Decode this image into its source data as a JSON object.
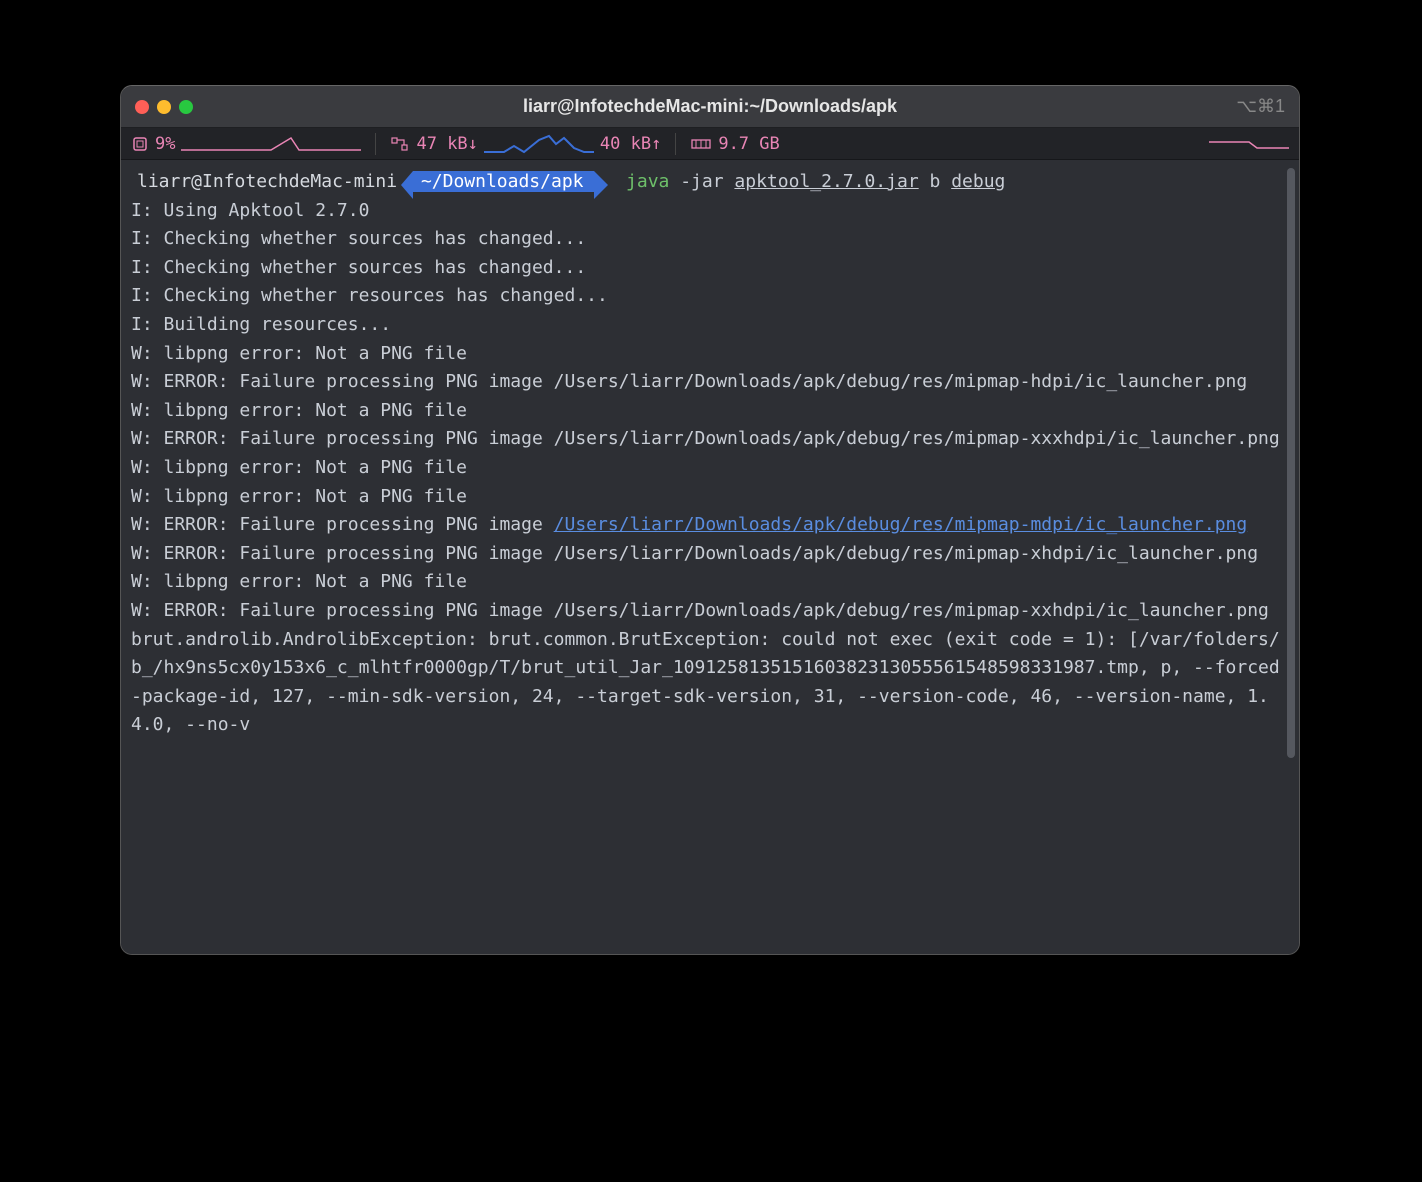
{
  "window": {
    "title": "liarr@InfotechdeMac-mini:~/Downloads/apk",
    "shortcut_hint": "⌥⌘1"
  },
  "status": {
    "cpu_percent": "9%",
    "net_down": "47 kB↓",
    "net_up": "40 kB↑",
    "ram": "9.7 GB"
  },
  "prompt": {
    "user_host": "liarr@InfotechdeMac-mini",
    "path": "~/Downloads/apk",
    "cmd_java": "java",
    "cmd_flag": "-jar",
    "cmd_jar": "apktool_2.7.0.jar",
    "cmd_b": "b",
    "cmd_target": "debug"
  },
  "lines": {
    "l1": "I: Using Apktool 2.7.0",
    "l2": "I: Checking whether sources has changed...",
    "l3": "I: Checking whether sources has changed...",
    "l4": "I: Checking whether resources has changed...",
    "l5": "I: Building resources...",
    "l6": "W: libpng error: Not a PNG file",
    "l7": "W: ERROR: Failure processing PNG image /Users/liarr/Downloads/apk/debug/res/mipmap-hdpi/ic_launcher.png",
    "l8": "W: libpng error: Not a PNG file",
    "l9": "W: ERROR: Failure processing PNG image /Users/liarr/Downloads/apk/debug/res/mipmap-xxxhdpi/ic_launcher.png",
    "l10": "W: libpng error: Not a PNG file",
    "l11": "W: libpng error: Not a PNG file",
    "l12a": "W: ERROR: Failure processing PNG image ",
    "l12b": "/Users/liarr/Downloads/apk/debug/res/mipmap-mdpi/ic_launcher.png",
    "l13": "W: ERROR: Failure processing PNG image /Users/liarr/Downloads/apk/debug/res/mipmap-xhdpi/ic_launcher.png",
    "l14": "W: libpng error: Not a PNG file",
    "l15": "W: ERROR: Failure processing PNG image /Users/liarr/Downloads/apk/debug/res/mipmap-xxhdpi/ic_launcher.png",
    "l16": "brut.androlib.AndrolibException: brut.common.BrutException: could not exec (exit code = 1): [/var/folders/b_/hx9ns5cx0y153x6_c_mlhtfr0000gp/T/brut_util_Jar_109125813515160382313055561548598331987.tmp, p, --forced-package-id, 127, --min-sdk-version, 24, --target-sdk-version, 31, --version-code, 46, --version-name, 1.4.0, --no-v"
  }
}
